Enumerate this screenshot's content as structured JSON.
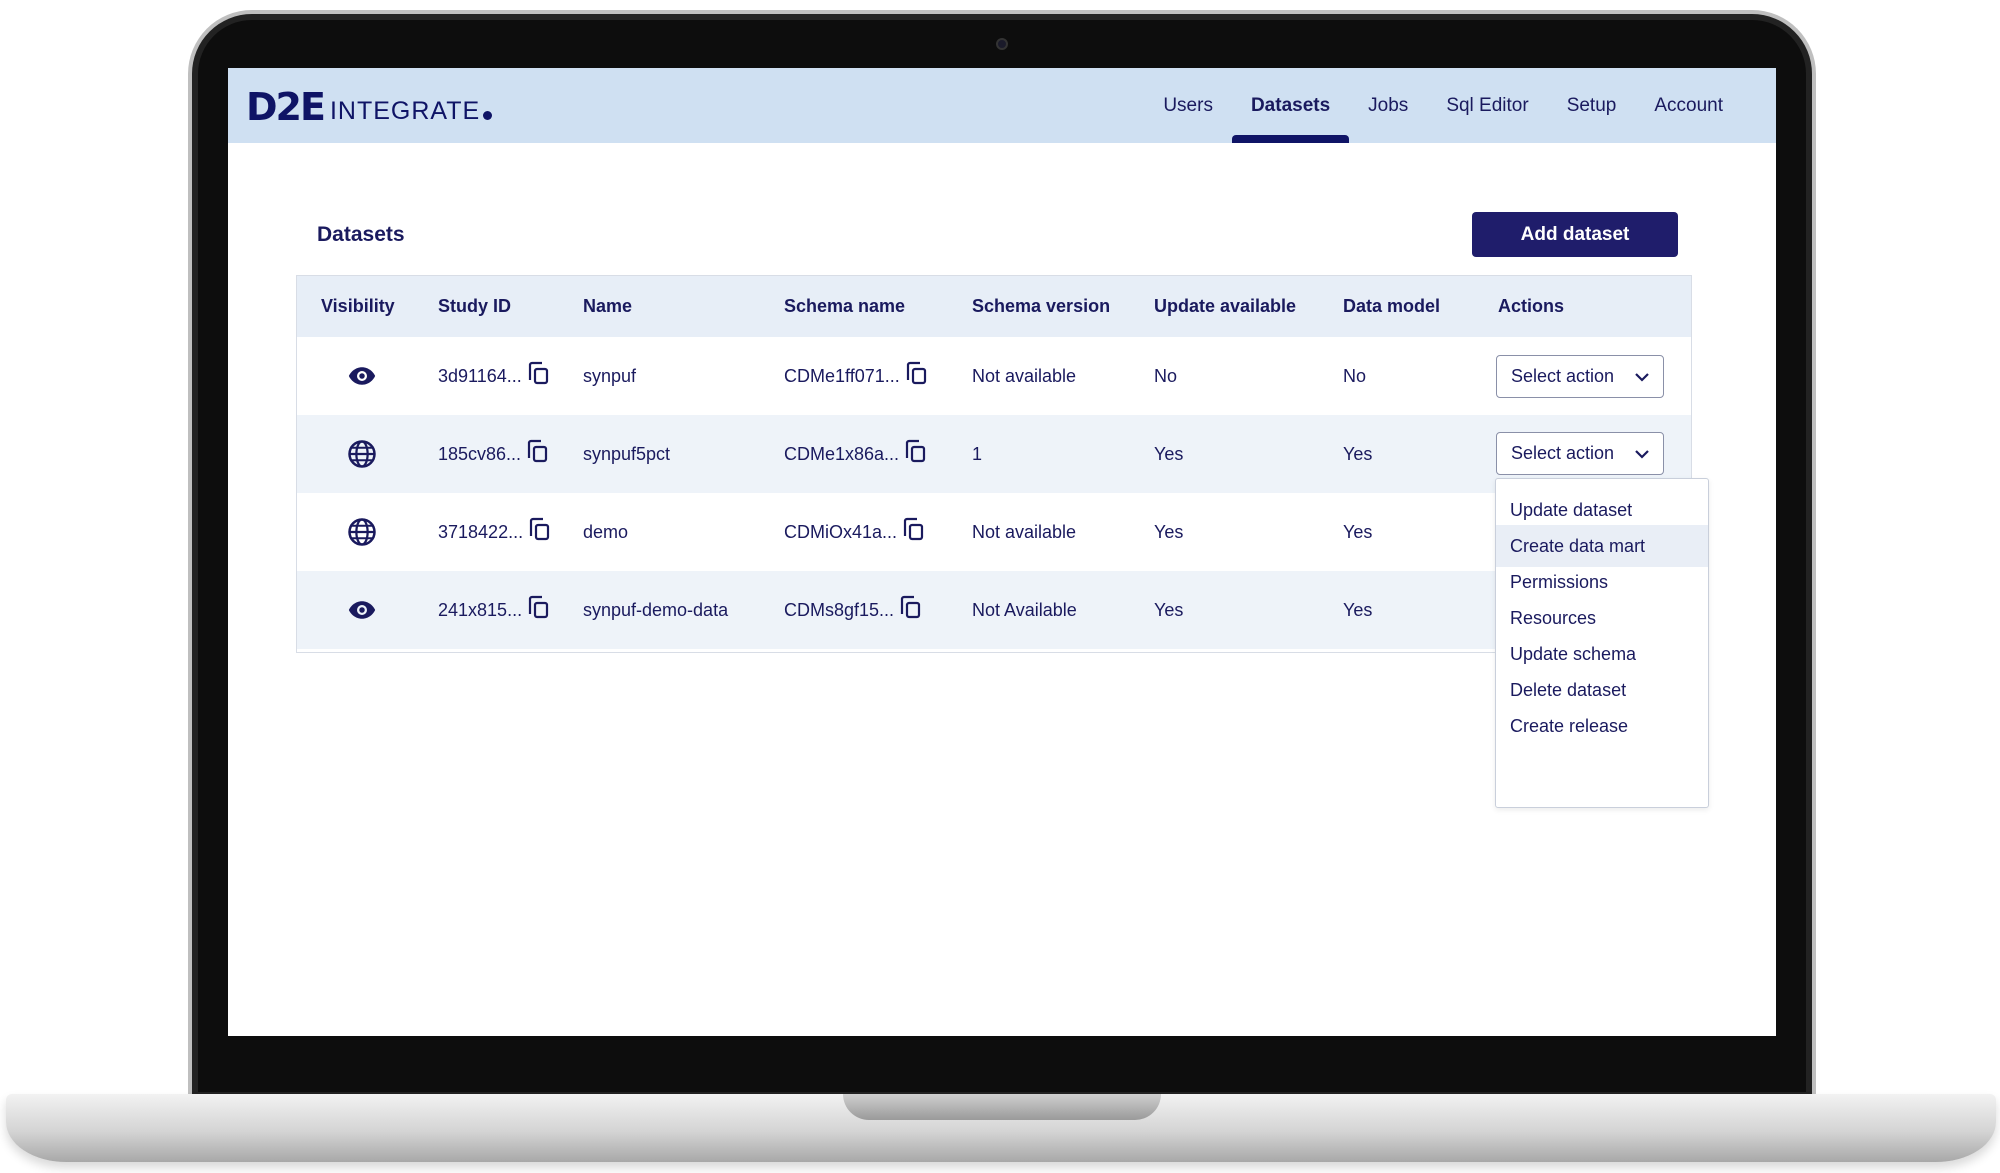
{
  "app": {
    "logo_mark": "D2E",
    "logo_text": "INTEGRATE"
  },
  "nav": {
    "items": [
      {
        "label": "Users",
        "active": false
      },
      {
        "label": "Datasets",
        "active": true
      },
      {
        "label": "Jobs",
        "active": false
      },
      {
        "label": "Sql Editor",
        "active": false
      },
      {
        "label": "Setup",
        "active": false
      },
      {
        "label": "Account",
        "active": false
      }
    ]
  },
  "page": {
    "title": "Datasets",
    "add_button": "Add dataset"
  },
  "table": {
    "columns": [
      "Visibility",
      "Study ID",
      "Name",
      "Schema name",
      "Schema version",
      "Update available",
      "Data model",
      "Actions"
    ],
    "rows": [
      {
        "visibility": "eye-icon",
        "study_id": "3d91164...",
        "name": "synpuf",
        "schema_name": "CDMe1ff071...",
        "schema_version": "Not available",
        "update_available": "No",
        "data_model": "No",
        "action": "Select action"
      },
      {
        "visibility": "globe-icon",
        "study_id": "185cv86...",
        "name": "synpuf5pct",
        "schema_name": "CDMe1x86a...",
        "schema_version": "1",
        "update_available": "Yes",
        "data_model": "Yes",
        "action": "Select action"
      },
      {
        "visibility": "globe-icon",
        "study_id": "3718422...",
        "name": "demo",
        "schema_name": "CDMiOx41a...",
        "schema_version": "Not available",
        "update_available": "Yes",
        "data_model": "Yes",
        "action": ""
      },
      {
        "visibility": "eye-icon",
        "study_id": "241x815...",
        "name": "synpuf-demo-data",
        "schema_name": "CDMs8gf15...",
        "schema_version": "Not Available",
        "update_available": "Yes",
        "data_model": "Yes",
        "action": ""
      }
    ]
  },
  "dropdown": {
    "items": [
      "Update dataset",
      "Create data mart",
      "Permissions",
      "Resources",
      "Update schema",
      "Delete dataset",
      "Create release"
    ],
    "highlighted_index": 1
  },
  "colors": {
    "topbar": "#cfe0f2",
    "primary": "#1f1d6b",
    "text": "#1a1a5e",
    "header_row": "#e7eef7",
    "alt_row": "#eef3f9"
  }
}
